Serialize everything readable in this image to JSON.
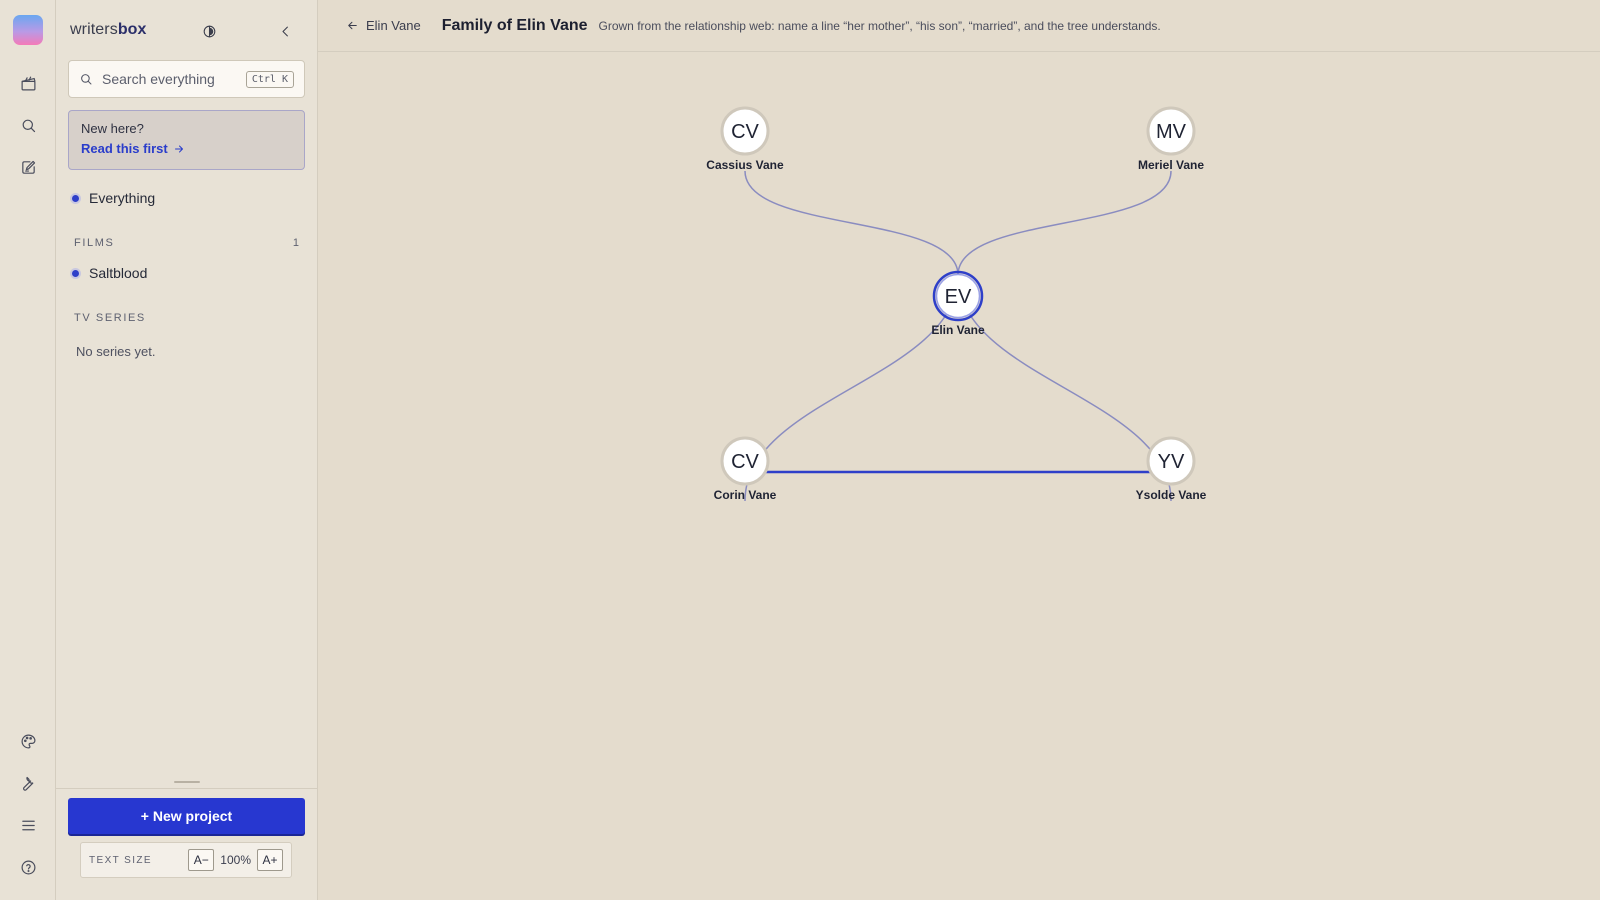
{
  "app": {
    "brand_prefix": "writers",
    "brand_suffix": "box"
  },
  "rail": {
    "icons": [
      "app-logo",
      "clapperboard-icon",
      "search-icon",
      "edit-note-icon",
      "palette-icon",
      "wrench-icon",
      "menu-icon",
      "help-icon"
    ]
  },
  "sidebar": {
    "search_placeholder": "Search everything",
    "search_shortcut": "Ctrl K",
    "intro_question": "New here?",
    "intro_link": "Read this first",
    "everything_label": "Everything",
    "films_header": "FILMS",
    "films_count": "1",
    "films": [
      {
        "label": "Saltblood"
      }
    ],
    "series_header": "TV SERIES",
    "series_empty": "No series yet.",
    "new_project_label": "+ New project",
    "text_size_label": "TEXT SIZE",
    "text_size_decrease": "A−",
    "text_size_value": "100%",
    "text_size_increase": "A+"
  },
  "header": {
    "back_label": "Elin Vane",
    "title": "Family of Elin Vane",
    "subtitle": "Grown from the relationship web: name a line “her mother”, “his son”, “married”, and the tree understands."
  },
  "tree": {
    "accent_color": "#2e3fc9",
    "edge_color": "#8a8cc0",
    "nodes": [
      {
        "id": "cassius",
        "initials": "CV",
        "name": "Cassius Vane",
        "focus": false
      },
      {
        "id": "meriel",
        "initials": "MV",
        "name": "Meriel Vane",
        "focus": false
      },
      {
        "id": "elin",
        "initials": "EV",
        "name": "Elin Vane",
        "focus": true
      },
      {
        "id": "corin",
        "initials": "CV",
        "name": "Corin Vane",
        "focus": false
      },
      {
        "id": "ysolde",
        "initials": "YV",
        "name": "Ysolde Vane",
        "focus": false
      }
    ],
    "edges": [
      {
        "from": "cassius",
        "to": "elin",
        "kind": "parent"
      },
      {
        "from": "meriel",
        "to": "elin",
        "kind": "parent"
      },
      {
        "from": "elin",
        "to": "corin",
        "kind": "child"
      },
      {
        "from": "elin",
        "to": "ysolde",
        "kind": "child"
      },
      {
        "from": "corin",
        "to": "ysolde",
        "kind": "spouse"
      }
    ]
  }
}
